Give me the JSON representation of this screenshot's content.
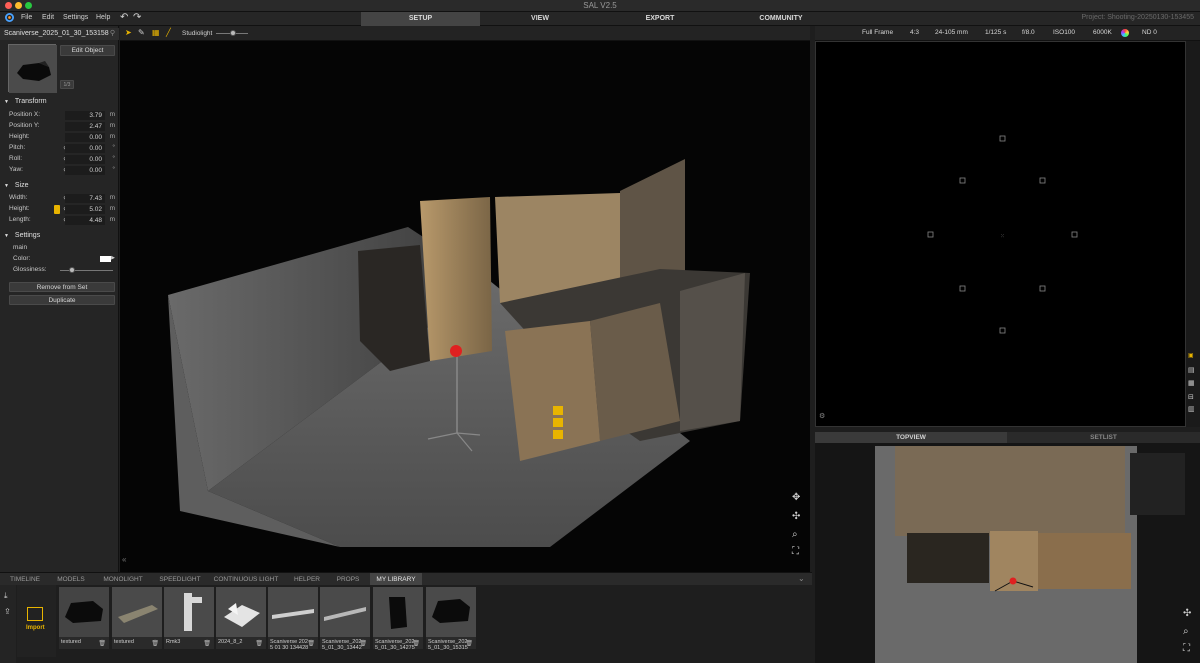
{
  "window": {
    "title": "SAL V2.5",
    "project": "Project: Shooting-20250130-153455"
  },
  "menu": {
    "file": "File",
    "edit": "Edit",
    "settings": "Settings",
    "help": "Help",
    "undo_icon": "undo-icon",
    "redo_icon": "redo-icon"
  },
  "modes": {
    "setup": "SETUP",
    "view": "VIEW",
    "export": "EXPORT",
    "community": "COMMUNITY",
    "active": "SETUP"
  },
  "viewport_toolbar": {
    "light_label": "Studiolight",
    "light_level": 0.5
  },
  "object": {
    "name": "Scaniverse_2025_01_30_153158",
    "edit_button": "Edit Object",
    "page_badge": "1/3"
  },
  "transform": {
    "title": "Transform",
    "position_x": {
      "label": "Position X:",
      "value": "3.79",
      "unit": "m"
    },
    "position_y": {
      "label": "Position Y:",
      "value": "2.47",
      "unit": "m"
    },
    "height": {
      "label": "Height:",
      "value": "0.00",
      "unit": "m"
    },
    "pitch": {
      "label": "Pitch:",
      "value": "0.00",
      "unit": "°"
    },
    "roll": {
      "label": "Roll:",
      "value": "0.00",
      "unit": "°"
    },
    "yaw": {
      "label": "Yaw:",
      "value": "0.00",
      "unit": "°"
    }
  },
  "size": {
    "title": "Size",
    "width": {
      "label": "Width:",
      "value": "7.43",
      "unit": "m"
    },
    "height": {
      "label": "Height:",
      "value": "5.02",
      "unit": "m"
    },
    "length": {
      "label": "Length:",
      "value": "4.48",
      "unit": "m"
    }
  },
  "settings": {
    "title": "Settings",
    "material": "main",
    "color_label": "Color:",
    "color_value": "#ffffff",
    "glossiness_label": "Glossiness:",
    "glossiness_level": 0.22,
    "remove_button": "Remove from Set",
    "duplicate_button": "Duplicate"
  },
  "camera": {
    "format": "Full Frame",
    "aspect": "4:3",
    "lens": "24-105 mm",
    "shutter": "1/125 s",
    "aperture": "f/8.0",
    "iso": "ISO100",
    "white_balance": "6000K",
    "nd": "ND 0"
  },
  "topview_tabs": {
    "topview": "TOPVIEW",
    "setlist": "SETLIST"
  },
  "bottom_tabs": [
    "TIMELINE",
    "MODELS",
    "MONOLIGHT",
    "SPEEDLIGHT",
    "CONTINUOUS LIGHT",
    "HELPER",
    "PROPS",
    "MY LIBRARY"
  ],
  "bottom_active": "MY LIBRARY",
  "library": {
    "import_label": "Import",
    "items": [
      {
        "caption": "textured"
      },
      {
        "caption": "textured"
      },
      {
        "caption": "Rmk3"
      },
      {
        "caption": "2024_8_2"
      },
      {
        "caption": "Scaniverse 2025 01 30 134428"
      },
      {
        "caption": "Scaniverse_2025_01_30_134428"
      },
      {
        "caption": "Scaniverse_2025_01_30_142757"
      },
      {
        "caption": "Scaniverse_2025_01_30_153158"
      }
    ]
  },
  "colors": {
    "accent_yellow": "#e8b400",
    "light_red": "#e02020",
    "panel_bg": "#252525"
  }
}
